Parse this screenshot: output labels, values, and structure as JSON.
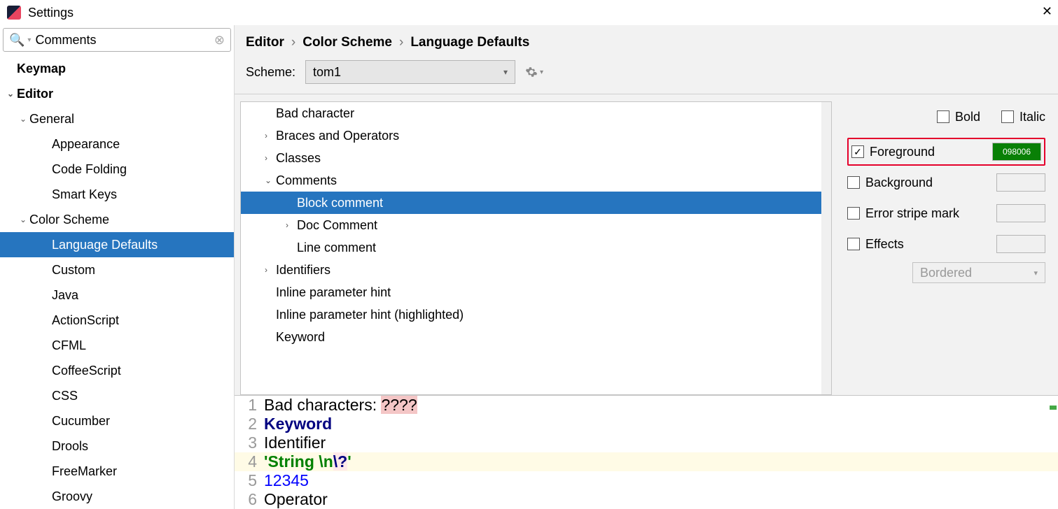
{
  "window": {
    "title": "Settings"
  },
  "search": {
    "value": "Comments"
  },
  "sidebar": [
    {
      "label": "Keymap",
      "level": 0,
      "chev": "",
      "bold": true
    },
    {
      "label": "Editor",
      "level": 0,
      "chev": "down",
      "bold": true
    },
    {
      "label": "General",
      "level": 1,
      "chev": "down"
    },
    {
      "label": "Appearance",
      "level": 2,
      "chev": ""
    },
    {
      "label": "Code Folding",
      "level": 2,
      "chev": ""
    },
    {
      "label": "Smart Keys",
      "level": 2,
      "chev": ""
    },
    {
      "label": "Color Scheme",
      "level": 1,
      "chev": "down"
    },
    {
      "label": "Language Defaults",
      "level": 2,
      "chev": "",
      "selected": true
    },
    {
      "label": "Custom",
      "level": 2,
      "chev": ""
    },
    {
      "label": "Java",
      "level": 2,
      "chev": ""
    },
    {
      "label": "ActionScript",
      "level": 2,
      "chev": ""
    },
    {
      "label": "CFML",
      "level": 2,
      "chev": ""
    },
    {
      "label": "CoffeeScript",
      "level": 2,
      "chev": ""
    },
    {
      "label": "CSS",
      "level": 2,
      "chev": ""
    },
    {
      "label": "Cucumber",
      "level": 2,
      "chev": ""
    },
    {
      "label": "Drools",
      "level": 2,
      "chev": ""
    },
    {
      "label": "FreeMarker",
      "level": 2,
      "chev": ""
    },
    {
      "label": "Groovy",
      "level": 2,
      "chev": ""
    }
  ],
  "breadcrumb": [
    "Editor",
    "Color Scheme",
    "Language Defaults"
  ],
  "scheme": {
    "label": "Scheme:",
    "value": "tom1"
  },
  "categories": [
    {
      "label": "Bad character",
      "depth": 1,
      "chev": ""
    },
    {
      "label": "Braces and Operators",
      "depth": 1,
      "chev": "right"
    },
    {
      "label": "Classes",
      "depth": 1,
      "chev": "right"
    },
    {
      "label": "Comments",
      "depth": 1,
      "chev": "down"
    },
    {
      "label": "Block comment",
      "depth": 2,
      "chev": "",
      "selected": true
    },
    {
      "label": "Doc Comment",
      "depth": 2,
      "chev": "right"
    },
    {
      "label": "Line comment",
      "depth": 2,
      "chev": ""
    },
    {
      "label": "Identifiers",
      "depth": 1,
      "chev": "right"
    },
    {
      "label": "Inline parameter hint",
      "depth": 1,
      "chev": ""
    },
    {
      "label": "Inline parameter hint (highlighted)",
      "depth": 1,
      "chev": ""
    },
    {
      "label": "Keyword",
      "depth": 1,
      "chev": ""
    }
  ],
  "props": {
    "bold": {
      "label": "Bold",
      "checked": false
    },
    "italic": {
      "label": "Italic",
      "checked": false
    },
    "foreground": {
      "label": "Foreground",
      "checked": true,
      "color": "#098006",
      "text": "098006"
    },
    "background": {
      "label": "Background",
      "checked": false
    },
    "error_stripe": {
      "label": "Error stripe mark",
      "checked": false
    },
    "effects": {
      "label": "Effects",
      "checked": false
    },
    "effects_type": "Bordered"
  },
  "preview": [
    {
      "n": 1,
      "html": "Bad characters: <span class='bad'>????</span>"
    },
    {
      "n": 2,
      "html": "<span class='kw'>Keyword</span>"
    },
    {
      "n": 3,
      "html": "Identifier"
    },
    {
      "n": 4,
      "html": "<span class='str'>'String \\n</span><span class='esc'>\\?</span><span class='str'>'</span>",
      "hl": true
    },
    {
      "n": 5,
      "html": "<span class='num'>12345</span>"
    },
    {
      "n": 6,
      "html": "Operator"
    }
  ]
}
